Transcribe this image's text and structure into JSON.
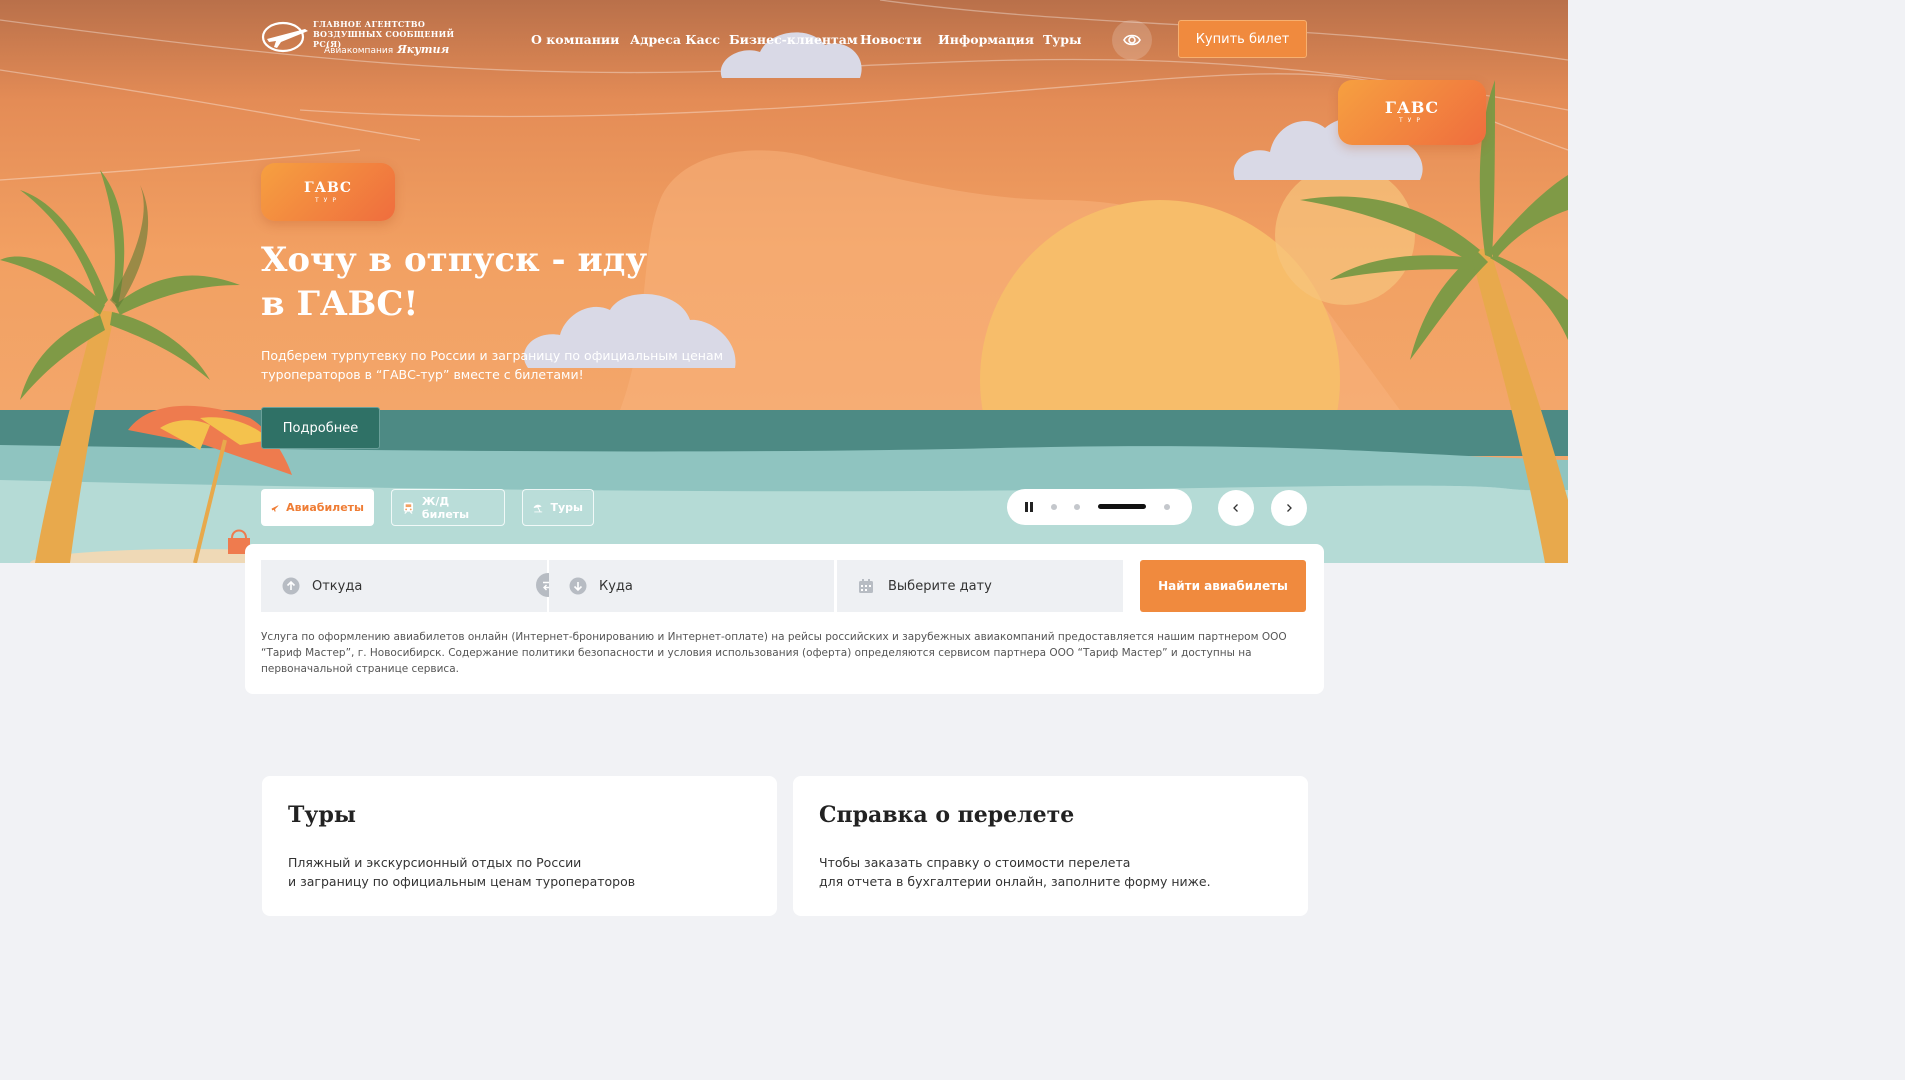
{
  "header": {
    "logo": {
      "line1": "ГЛАВНОЕ АГЕНТСТВО",
      "line2": "ВОЗДУШНЫХ СООБЩЕНИЙ РС(Я)",
      "airline_prefix": "Авиакомпания",
      "airline_name": "Якутия"
    },
    "nav": [
      "О компании",
      "Адреса Касс",
      "Бизнес-клиентам",
      "Новости",
      "Информация",
      "Туры"
    ],
    "accessibility_icon": "eye-icon",
    "buy_button": "Купить билет"
  },
  "brand": {
    "badge_title": "ГАВС",
    "badge_sub": "ТУР",
    "accent": "#f08a3e",
    "teal": "#2f7166"
  },
  "hero": {
    "title": "Хочу в отпуск - иду в ГАВС!",
    "subtitle": "Подберем турпутевку по России и заграницу по официальным ценам туроператоров в “ГАВС-тур” вместе с билетами!",
    "more_button": "Подробнее"
  },
  "tabs": [
    {
      "label": "Авиабилеты",
      "icon": "plane-icon",
      "active": true
    },
    {
      "label": "Ж/Д билеты",
      "icon": "train-icon",
      "active": false
    },
    {
      "label": "Туры",
      "icon": "beach-umbrella-icon",
      "active": false
    }
  ],
  "slider": {
    "slides": 4,
    "active_index": 2,
    "pause_icon": "pause-icon"
  },
  "search": {
    "from_placeholder": "Откуда",
    "to_placeholder": "Куда",
    "date_placeholder": "Выберите дату",
    "find_button": "Найти авиабилеты",
    "disclaimer": "Услуга по оформлению авиабилетов онлайн (Интернет-бронированию и Интернет-оплате) на рейсы российских и зарубежных авиакомпаний предоставляется нашим партнером ООО “Тариф Мастер”, г. Новосибирск. Содержание политики безопасности и условия использования (оферта) определяются сервисом партнера ООО “Тариф Мастер” и доступны на первоначальной странице сервиса."
  },
  "cards": [
    {
      "title": "Туры",
      "text_line1": "Пляжный и экскурсионный отдых по России",
      "text_line2": "и заграницу по официальным ценам туроператоров"
    },
    {
      "title": "Справка о перелете",
      "text_line1": "Чтобы заказать справку о стоимости перелета",
      "text_line2": "для отчета в бухгалтерии онлайн, заполните форму ниже."
    }
  ]
}
